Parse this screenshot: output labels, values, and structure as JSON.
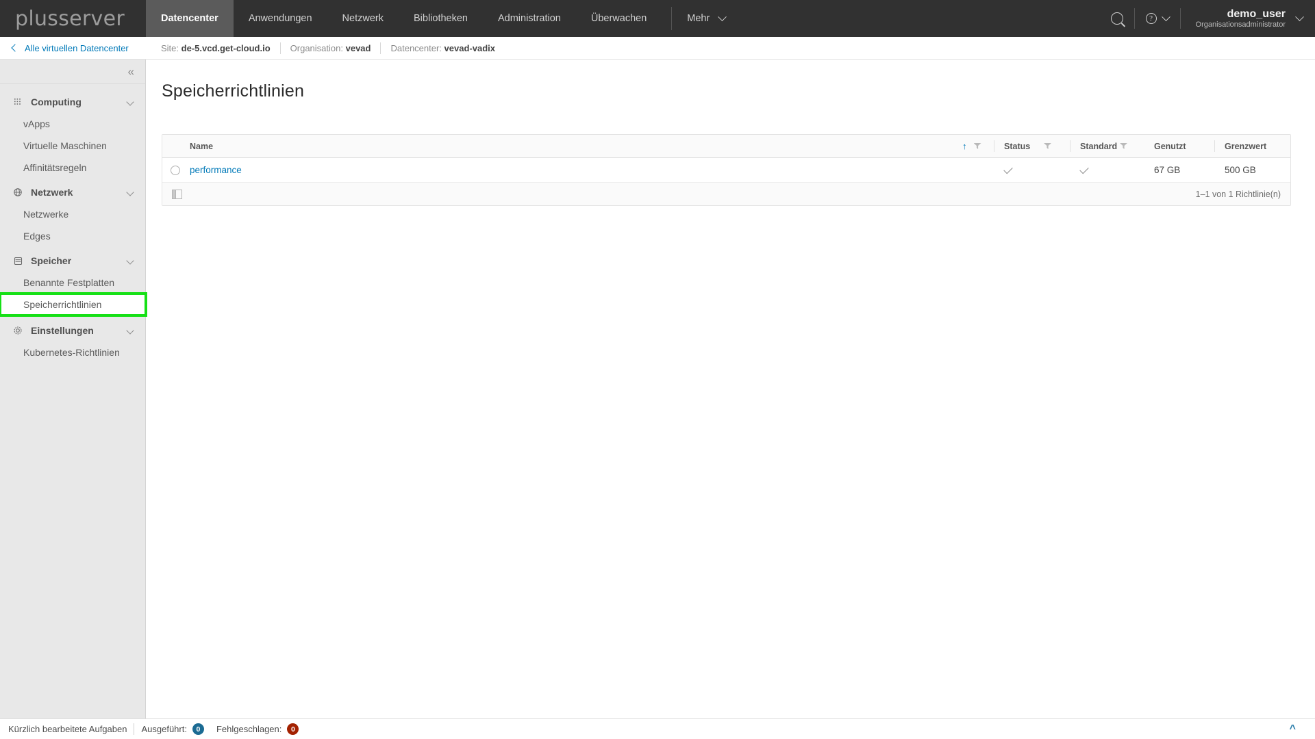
{
  "topnav": {
    "brand": "plusserver",
    "items": [
      {
        "label": "Datencenter",
        "active": true
      },
      {
        "label": "Anwendungen",
        "active": false
      },
      {
        "label": "Netzwerk",
        "active": false
      },
      {
        "label": "Bibliotheken",
        "active": false
      },
      {
        "label": "Administration",
        "active": false
      },
      {
        "label": "Überwachen",
        "active": false
      }
    ],
    "more_label": "Mehr",
    "search_icon": "search-icon",
    "help_icon": "help-circle-icon",
    "user_name": "demo_user",
    "user_role": "Organisationsadministrator"
  },
  "breadcrumb": {
    "back_label": "Alle virtuellen Datencenter",
    "crumbs": [
      {
        "label": "Site:",
        "value": "de-5.vcd.get-cloud.io"
      },
      {
        "label": "Organisation:",
        "value": "vevad"
      },
      {
        "label": "Datencenter:",
        "value": "vevad-vadix"
      }
    ]
  },
  "sidebar": {
    "collapse_icon": "double-chevron-left-icon",
    "groups": [
      {
        "label": "Computing",
        "icon": "grid-dots-icon",
        "items": [
          {
            "label": "vApps",
            "highlighted": false
          },
          {
            "label": "Virtuelle Maschinen",
            "highlighted": false
          },
          {
            "label": "Affinitätsregeln",
            "highlighted": false
          }
        ]
      },
      {
        "label": "Netzwerk",
        "icon": "network-globe-icon",
        "items": [
          {
            "label": "Netzwerke",
            "highlighted": false
          },
          {
            "label": "Edges",
            "highlighted": false
          }
        ]
      },
      {
        "label": "Speicher",
        "icon": "storage-database-icon",
        "items": [
          {
            "label": "Benannte Festplatten",
            "highlighted": false
          },
          {
            "label": "Speicherrichtlinien",
            "highlighted": true
          }
        ]
      },
      {
        "label": "Einstellungen",
        "icon": "gear-icon",
        "items": [
          {
            "label": "Kubernetes-Richtlinien",
            "highlighted": false
          }
        ]
      }
    ]
  },
  "main": {
    "page_title": "Speicherrichtlinien",
    "table": {
      "columns": {
        "name": "Name",
        "status": "Status",
        "standard": "Standard",
        "genutzt": "Genutzt",
        "grenzwert": "Grenzwert"
      },
      "sort_icon": "sort-ascending-arrow-icon",
      "filter_icon": "filter-funnel-icon",
      "rows": [
        {
          "name": "performance",
          "status": "check",
          "standard": "check",
          "genutzt": "67 GB",
          "grenzwert": "500 GB"
        }
      ],
      "footer": {
        "columns_icon": "column-settings-icon",
        "count_text": "1–1 von 1 Richtlinie(n)"
      }
    }
  },
  "statusbar": {
    "label": "Kürzlich bearbeitete Aufgaben",
    "running_label": "Ausgeführt:",
    "running_count": "0",
    "failed_label": "Fehlgeschlagen:",
    "failed_count": "0",
    "expand_icon": "double-chevron-up-icon"
  },
  "colors": {
    "topnav_bg": "#313131",
    "topnav_active": "#5b5b5b",
    "link": "#0079b8",
    "highlight": "#16e016",
    "badge_blue": "#1b6b93",
    "badge_red": "#a32100"
  }
}
